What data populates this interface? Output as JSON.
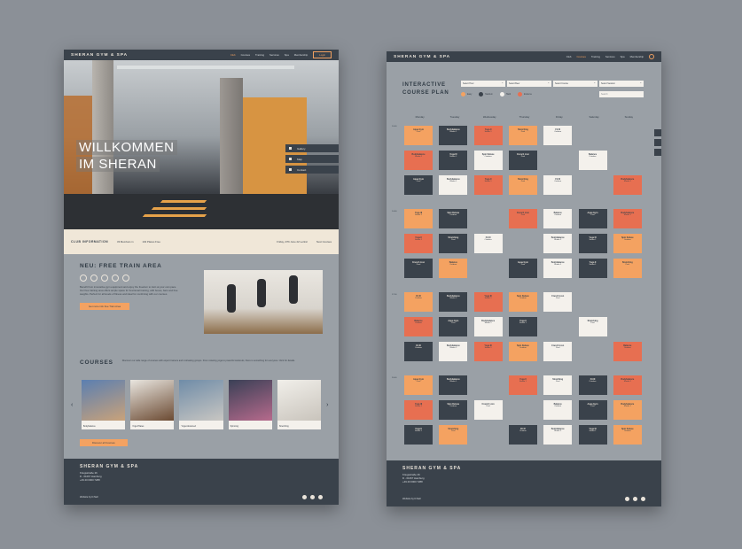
{
  "nav": {
    "brand": "SHERAN GYM & SPA",
    "links": [
      "Club",
      "Courses",
      "Training",
      "Services",
      "Spa",
      "Membership"
    ],
    "login": "Login"
  },
  "hero": {
    "title_line1": "WILLKOMMEN",
    "title_line2": "IM SHERAN",
    "menu": [
      "Gallery",
      "Map",
      "Contact"
    ]
  },
  "info": {
    "title": "CLUB INFORMATION",
    "members": "33 Members in",
    "spaces": "102 Places Free",
    "hours": "Friday, 27th June 22  Lezinic",
    "next_courses": "Next Courses"
  },
  "train": {
    "title": "NEU: FREE TRAIN AREA",
    "text": "Benefit from innovative gym equipment and enjoy the freedom to train at your own pace. Our free training area offers ample space for functional training, with boxes, bars and free weights. Perfect for all levels of fitness and ideal for combining with our courses.",
    "button": "Get more info free Train Area"
  },
  "courses": {
    "title": "COURSES",
    "text": "Discover our wide range of courses with expert trainers and motivating groups. From relaxing yoga to powerful workouts, there is something for everyone. Click for details.",
    "cards": [
      "Bodybalance",
      "Yoga Pilates",
      "Yoga Advanced",
      "Spinning",
      "Stretching"
    ],
    "button": "Discover all Courses"
  },
  "footer": {
    "brand": "SHERAN GYM & SPA",
    "address1": "Kriegsstraße 26",
    "address2": "D - 01067 Hamburg",
    "phone": "+49 40 0000 7288",
    "credit": "Website by D.Nell"
  },
  "plan": {
    "title_line1": "INTERACTIVE",
    "title_line2": "COURSE PLAN",
    "filters": [
      "Select Hour",
      "Select Beer",
      "Select Course",
      "Select Session"
    ],
    "legend": [
      "Easy",
      "Medium",
      "Hard",
      "Extreme"
    ],
    "search_placeholder": "Search",
    "days": [
      "Monday",
      "Tuesday",
      "Wednesday",
      "Thursday",
      "Friday",
      "Saturday",
      "Sunday"
    ],
    "times": [
      "10:00",
      "14:00",
      "17:00",
      "20:00"
    ],
    "slots": [
      {
        "name": "Aqua Gym",
        "sub": "Pool"
      },
      {
        "name": "Bodybalance",
        "sub": "Studio 1"
      },
      {
        "name": "Yoga II",
        "sub": "Studio 1"
      },
      {
        "name": "Stretching",
        "sub": "Pool"
      },
      {
        "name": "Fit III",
        "sub": "Outdoor"
      },
      {
        "name": "Bodybalance",
        "sub": "Studio 2"
      },
      {
        "name": "Yoga III",
        "sub": "Studio 1"
      },
      {
        "name": "Spin Deluxe",
        "sub": "Outdoor"
      },
      {
        "name": "Crunch Lion",
        "sub": "Pool"
      },
      {
        "name": "Balance",
        "sub": "Outdoor"
      }
    ]
  },
  "colors": {
    "dark": "#3a424b",
    "orange": "#f4a261",
    "red": "#e76f51",
    "cream": "#f4f1ec"
  }
}
